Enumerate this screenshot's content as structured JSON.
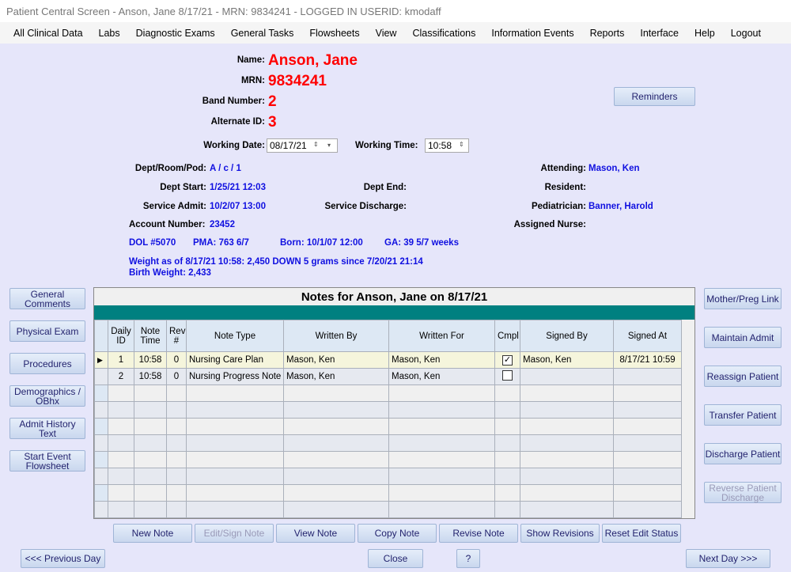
{
  "window": {
    "title": "Patient Central Screen - Anson, Jane   8/17/21  -  MRN: 9834241   -  LOGGED IN USERID: kmodaff"
  },
  "menu": [
    "All Clinical Data",
    "Labs",
    "Diagnostic Exams",
    "General Tasks",
    "Flowsheets",
    "View",
    "Classifications",
    "Information Events",
    "Reports",
    "Interface",
    "Help",
    "Logout"
  ],
  "patient": {
    "name_label": "Name:",
    "name": "Anson, Jane",
    "mrn_label": "MRN:",
    "mrn": "9834241",
    "band_label": "Band Number:",
    "band": "2",
    "alt_label": "Alternate ID:",
    "alt": "3",
    "working_date_label": "Working Date:",
    "working_date": "08/17/21",
    "working_time_label": "Working Time:",
    "working_time": "10:58",
    "dept_label": "Dept/Room/Pod:",
    "dept": "A / c / 1",
    "dept_start_label": "Dept Start:",
    "dept_start": "1/25/21 12:03",
    "dept_end_label": "Dept End:",
    "service_admit_label": "Service Admit:",
    "service_admit": "10/2/07 13:00",
    "service_discharge_label": "Service Discharge:",
    "account_label": "Account Number:",
    "account": "23452",
    "attending_label": "Attending:",
    "attending": "Mason, Ken",
    "resident_label": "Resident:",
    "pediatrician_label": "Pediatrician:",
    "pediatrician": "Banner, Harold",
    "nurse_label": "Assigned Nurse:",
    "dol": "DOL #5070",
    "pma": "PMA: 763 6/7",
    "born": "Born: 10/1/07 12:00",
    "ga": "GA: 39 5/7 weeks",
    "weight": "Weight as of 8/17/21 10:58: 2,450  DOWN 5 grams since 7/20/21 21:14",
    "birth_weight": "Birth Weight: 2,433"
  },
  "reminders": "Reminders",
  "left_buttons": [
    "General Comments",
    "Physical Exam",
    "Procedures",
    "Demographics / OBhx",
    "Admit History Text",
    "Start Event Flowsheet"
  ],
  "right_buttons": [
    {
      "label": "Mother/Preg Link"
    },
    {
      "label": "Maintain Admit"
    },
    {
      "label": "Reassign Patient"
    },
    {
      "label": "Transfer Patient"
    },
    {
      "label": "Discharge Patient"
    },
    {
      "label": "Reverse Patient Discharge",
      "disabled": true
    }
  ],
  "notes": {
    "title": "Notes for Anson, Jane on 8/17/21",
    "columns": [
      "Daily ID",
      "Note Time",
      "Rev #",
      "Note Type",
      "Written By",
      "Written For",
      "Cmpl",
      "Signed By",
      "Signed At"
    ],
    "rows": [
      {
        "id": "1",
        "time": "10:58",
        "rev": "0",
        "type": "Nursing Care Plan",
        "by": "Mason, Ken",
        "for": "Mason, Ken",
        "cmpl": true,
        "signed_by": "Mason, Ken",
        "signed_at": "8/17/21 10:59"
      },
      {
        "id": "2",
        "time": "10:58",
        "rev": "0",
        "type": "Nursing Progress Note",
        "by": "Mason, Ken",
        "for": "Mason, Ken",
        "cmpl": false,
        "signed_by": "",
        "signed_at": ""
      }
    ]
  },
  "note_buttons": [
    {
      "label": "New Note"
    },
    {
      "label": "Edit/Sign Note",
      "disabled": true
    },
    {
      "label": "View Note"
    },
    {
      "label": "Copy Note"
    },
    {
      "label": "Revise Note"
    },
    {
      "label": "Show Revisions"
    },
    {
      "label": "Reset Edit Status"
    }
  ],
  "bottom": {
    "prev": "<<< Previous Day",
    "close": "Close",
    "help": "?",
    "next": "Next Day >>>"
  },
  "colors": {
    "background": "#e6e6fa",
    "accent": "#008080",
    "value_text": "#1010e0",
    "highlight": "#ff0000"
  }
}
